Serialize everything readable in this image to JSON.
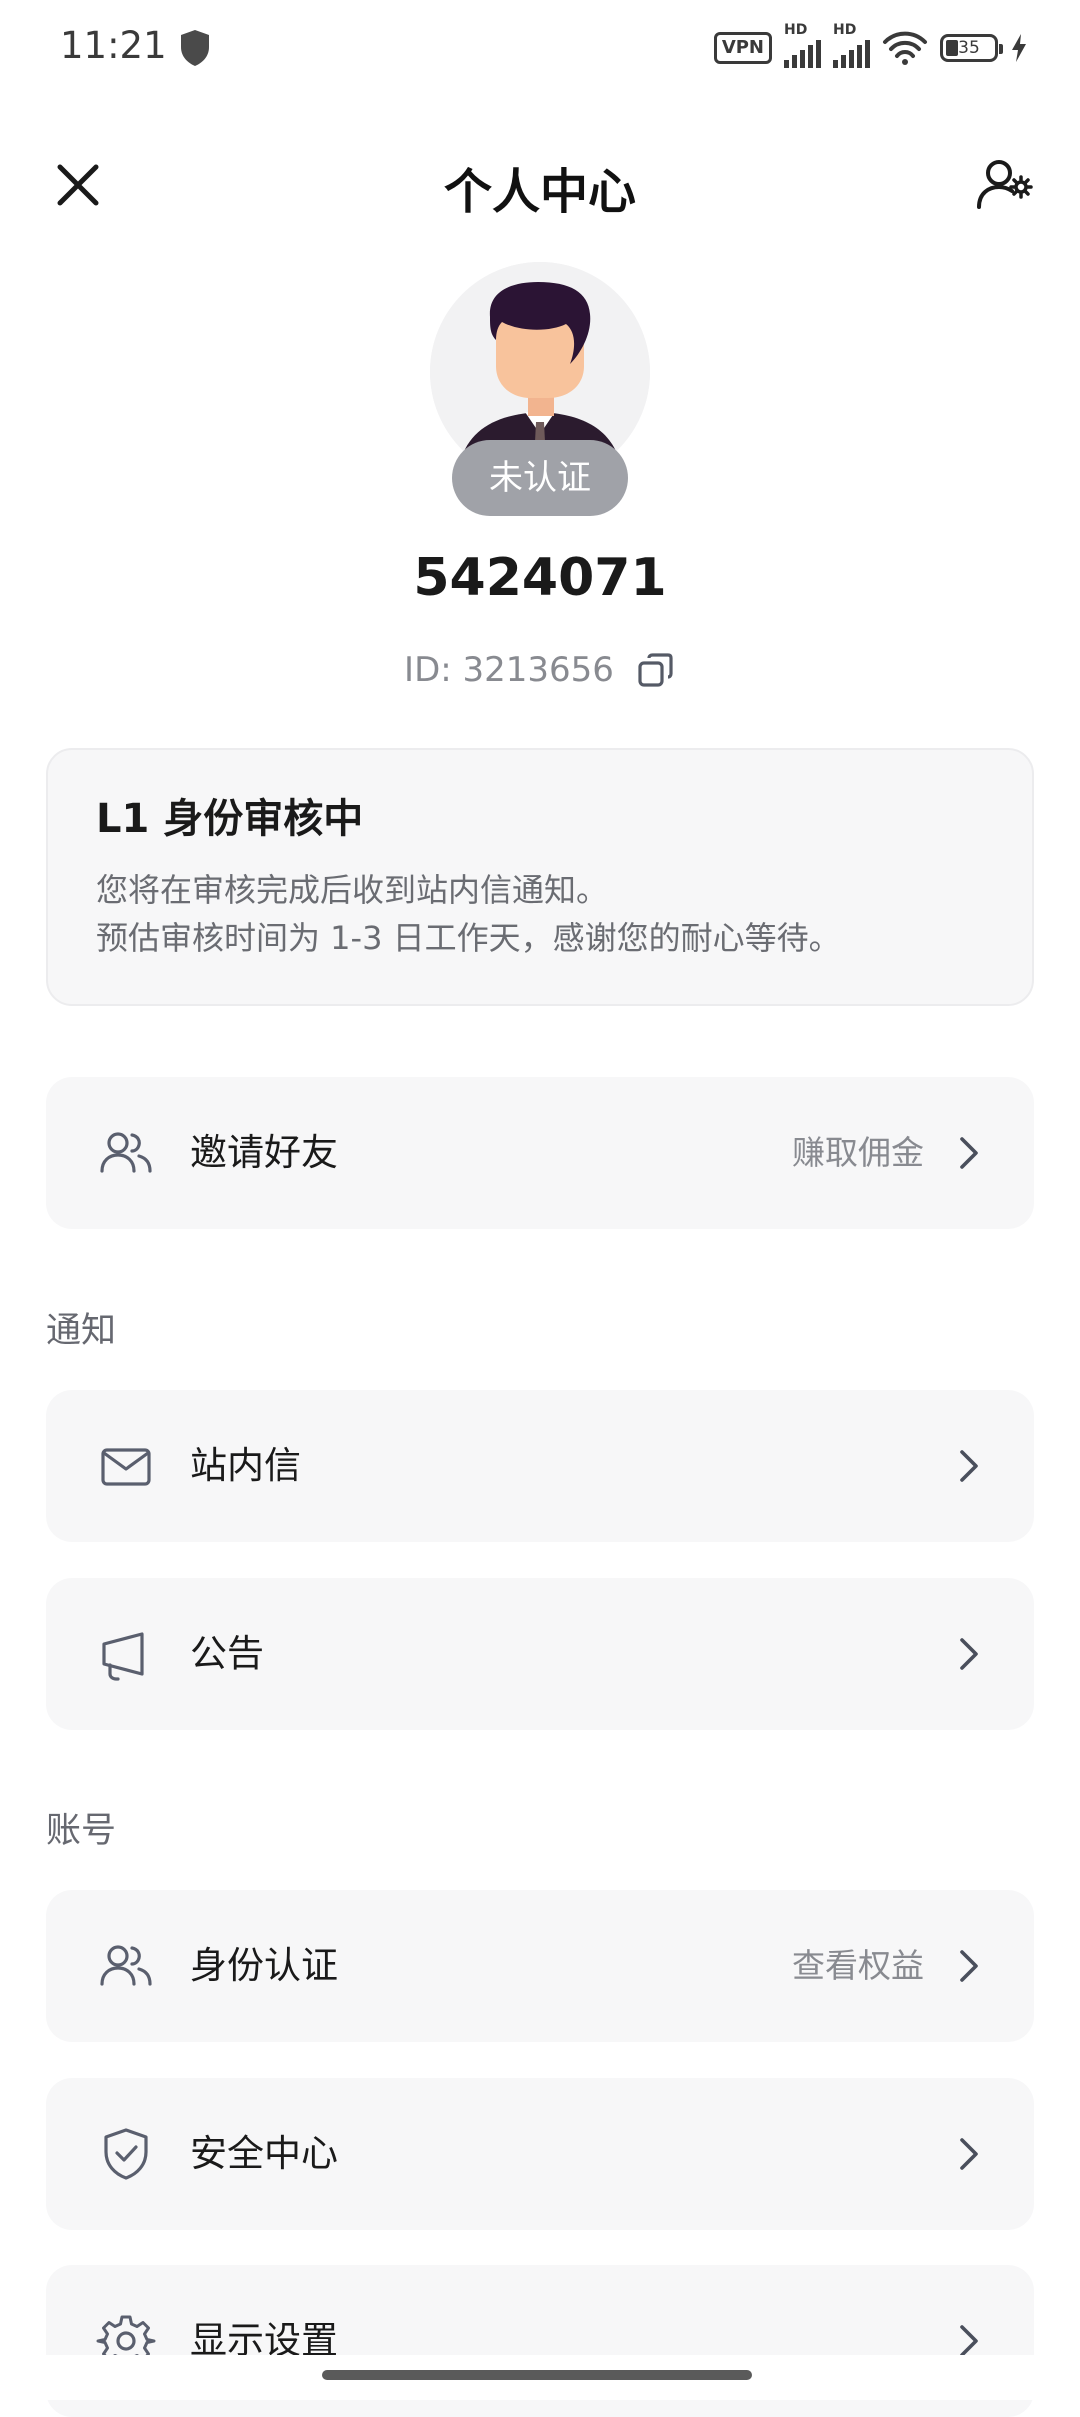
{
  "status_bar": {
    "time": "11:21",
    "vpn": "VPN",
    "hd1": "HD",
    "hd2": "HD",
    "battery": "35"
  },
  "header": {
    "title": "个人中心"
  },
  "profile": {
    "verify_status": "未认证",
    "username": "5424071",
    "id_text": "ID: 3213656"
  },
  "review_card": {
    "title": "L1 身份审核中",
    "line1": "您将在审核完成后收到站内信通知。",
    "line2": "预估审核时间为 1-3 日工作天，感谢您的耐心等待。"
  },
  "invite": {
    "label": "邀请好友",
    "hint": "赚取佣金"
  },
  "sections": {
    "notifications": "通知",
    "account": "账号"
  },
  "notifications": {
    "inbox": "站内信",
    "announcements": "公告"
  },
  "account": {
    "identity": "身份认证",
    "identity_hint": "查看权益",
    "security": "安全中心",
    "display": "显示设置"
  },
  "colors": {
    "card_bg": "#f7f7f8",
    "badge_bg": "#a0a2a8",
    "icon": "#5a5f6e"
  }
}
